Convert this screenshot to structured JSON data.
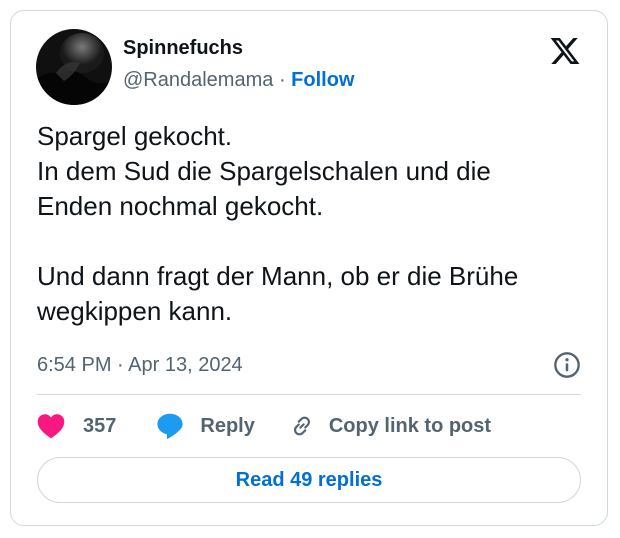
{
  "author": {
    "display_name": "Spinnefuchs",
    "handle": "@Randalemama",
    "separator": "·",
    "follow_label": "Follow"
  },
  "tweet": {
    "lines": [
      "Spargel gekocht.",
      "In dem Sud die Spargelschalen und die",
      "Enden nochmal gekocht.",
      "Und dann fragt der Mann, ob er die Brühe",
      "wegkippen kann."
    ],
    "timestamp": "6:54 PM · Apr 13, 2024"
  },
  "actions": {
    "like_count": "357",
    "reply_label": "Reply",
    "copy_label": "Copy link to post"
  },
  "read_replies_label": "Read 49 replies",
  "icons": {
    "brand": "x-logo-icon",
    "info": "info-icon",
    "like": "heart-icon",
    "reply": "speech-bubble-icon",
    "copy": "link-icon"
  },
  "colors": {
    "text": "#0f1419",
    "secondary": "#536471",
    "accent": "#006fd6",
    "like": "#f91880",
    "reply": "#1d9bf0",
    "border": "#cfd9de"
  }
}
